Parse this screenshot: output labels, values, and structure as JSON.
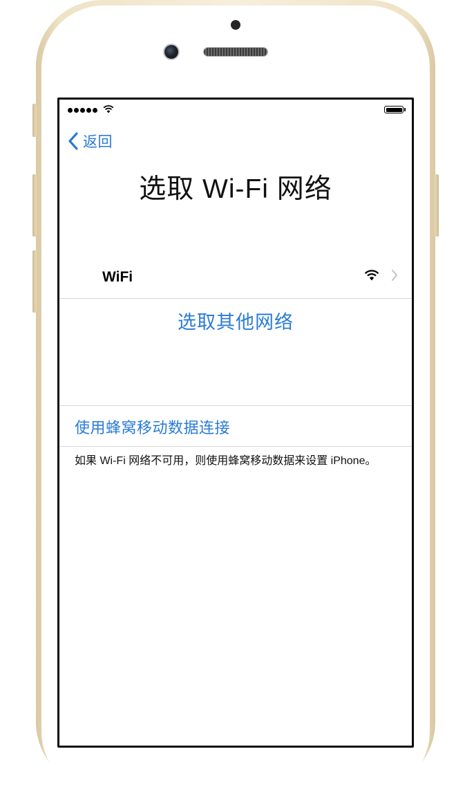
{
  "status_bar": {
    "signal_dots": 5,
    "battery_level": 1.0
  },
  "nav": {
    "back_label": "返回"
  },
  "page": {
    "title": "选取 Wi-Fi 网络"
  },
  "networks": [
    {
      "name": "WiFi",
      "icon": "wifi-icon",
      "accessory": "chevron-right-icon"
    }
  ],
  "other_network_label": "选取其他网络",
  "cellular": {
    "link_label": "使用蜂窝移动数据连接",
    "footnote": "如果 Wi-Fi 网络不可用，则使用蜂窝移动数据来设置 iPhone。"
  },
  "colors": {
    "accent": "#2a7bd6",
    "separator": "#d7d7d7",
    "frame_gold": "#efe3c6"
  }
}
